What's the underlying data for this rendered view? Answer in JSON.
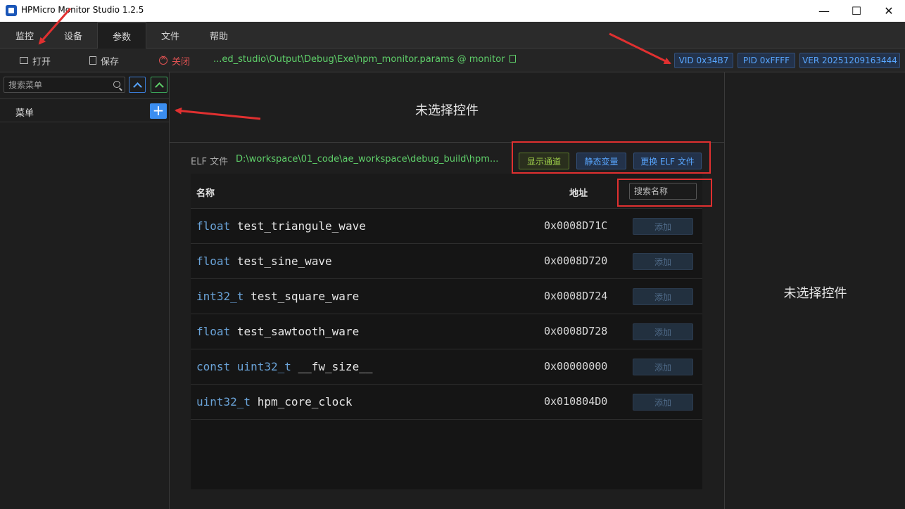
{
  "window": {
    "title": "HPMicro Monitor Studio 1.2.5",
    "controls": {
      "minimize": "—",
      "maximize": "☐",
      "close": "✕"
    }
  },
  "menu": {
    "tabs": [
      {
        "label": "监控"
      },
      {
        "label": "设备"
      },
      {
        "label": "参数",
        "active": true
      },
      {
        "label": "文件"
      },
      {
        "label": "帮助"
      }
    ]
  },
  "toolbar": {
    "open_label": "打开",
    "save_label": "保存",
    "close_label": "关闭",
    "params_path": "...ed_studio\\Output\\Debug\\Exe\\hpm_monitor.params @ monitor",
    "vid": "VID 0x34B7",
    "pid": "PID 0xFFFF",
    "ver": "VER 20251209163444"
  },
  "sidebar": {
    "search_placeholder": "搜索菜单",
    "menu_label": "菜单",
    "add_label": "+"
  },
  "main": {
    "no_selection": "未选择控件",
    "elf_label": "ELF 文件",
    "elf_path": "D:\\workspace\\01_code\\ae_workspace\\debug_build\\hpm...",
    "show_channel_label": "显示通道",
    "static_var_label": "静态变量",
    "change_elf_label": "更换 ELF 文件",
    "table": {
      "col_name": "名称",
      "col_addr": "地址",
      "search_placeholder": "搜索名称",
      "add_label": "添加",
      "rows": [
        {
          "type": "float",
          "name": "test_triangule_wave",
          "addr": "0x0008D71C"
        },
        {
          "type": "float",
          "name": "test_sine_wave",
          "addr": "0x0008D720"
        },
        {
          "type": "int32_t",
          "name": "test_square_ware",
          "addr": "0x0008D724"
        },
        {
          "type": "float",
          "name": "test_sawtooth_ware",
          "addr": "0x0008D728"
        },
        {
          "type": "const uint32_t",
          "name": "__fw_size__",
          "addr": "0x00000000"
        },
        {
          "type": "uint32_t",
          "name": "hpm_core_clock",
          "addr": "0x010804D0"
        }
      ]
    }
  },
  "right_panel": {
    "no_selection": "未选择控件"
  },
  "colors": {
    "accent_blue": "#3b8ef0",
    "green_text": "#5fd06a",
    "annotation_red": "#e03030"
  }
}
